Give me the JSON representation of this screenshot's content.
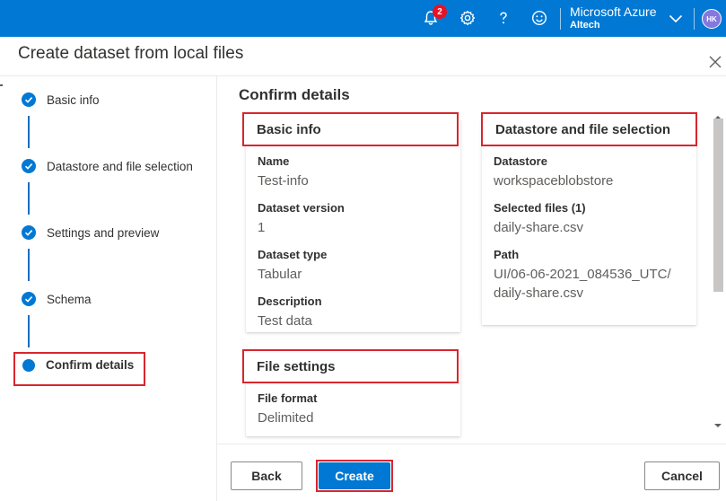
{
  "topbar": {
    "notification_count": "2",
    "tenant_name": "Microsoft Azure",
    "tenant_directory": "Altech",
    "avatar_initials": "HK"
  },
  "panel": {
    "title": "Create dataset from local files"
  },
  "stepper": {
    "steps": [
      {
        "label": "Basic info",
        "state": "complete"
      },
      {
        "label": "Datastore and file selection",
        "state": "complete"
      },
      {
        "label": "Settings and preview",
        "state": "complete"
      },
      {
        "label": "Schema",
        "state": "complete"
      },
      {
        "label": "Confirm details",
        "state": "active"
      }
    ]
  },
  "content": {
    "title": "Confirm details",
    "basic_info": {
      "heading": "Basic info",
      "fields": [
        {
          "label": "Name",
          "value": "Test-info"
        },
        {
          "label": "Dataset version",
          "value": "1"
        },
        {
          "label": "Dataset type",
          "value": "Tabular"
        },
        {
          "label": "Description",
          "value": "Test data"
        }
      ]
    },
    "datastore": {
      "heading": "Datastore and file selection",
      "fields": [
        {
          "label": "Datastore",
          "value": "workspaceblobstore"
        },
        {
          "label": "Selected files (1)",
          "value": "daily-share.csv"
        },
        {
          "label": "Path",
          "value": "UI/06-06-2021_084536_UTC/daily-share.csv"
        }
      ]
    },
    "file_settings": {
      "heading": "File settings",
      "fields": [
        {
          "label": "File format",
          "value": "Delimited"
        }
      ]
    }
  },
  "footer": {
    "back_label": "Back",
    "create_label": "Create",
    "cancel_label": "Cancel"
  },
  "colors": {
    "brand": "#0078d4",
    "highlight": "#d8262e",
    "badge": "#e81123"
  },
  "icons": [
    "bell-icon",
    "gear-icon",
    "help-icon",
    "feedback-smiley-icon",
    "chevron-down-icon",
    "close-icon",
    "checkmark-icon"
  ]
}
